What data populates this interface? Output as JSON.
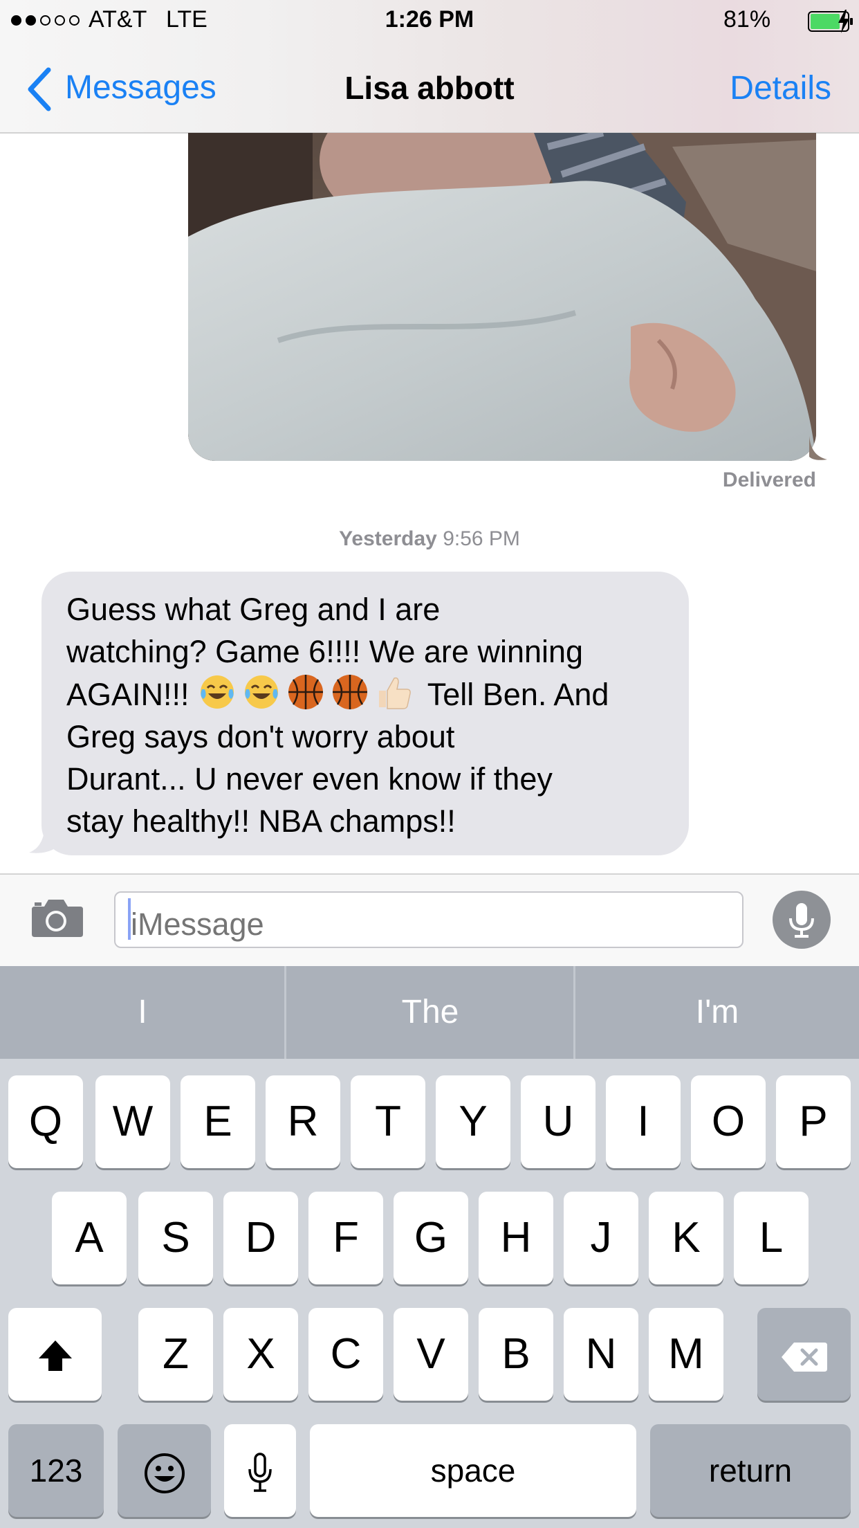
{
  "status_bar": {
    "carrier": "AT&T",
    "network": "LTE",
    "time": "1:26 PM",
    "battery_percent": "81%",
    "battery_level": 0.81,
    "signal_bars": 2,
    "signal_max": 5,
    "colors": {
      "battery": "#4cd964"
    }
  },
  "nav": {
    "back_label": "Messages",
    "title": "Lisa abbott",
    "details_label": "Details",
    "accent_color": "#1a81f4"
  },
  "conversation": {
    "photo_message": {
      "icon": "photo-attachment",
      "status": "Delivered"
    },
    "timestamp": {
      "day": "Yesterday",
      "time": "9:56 PM"
    },
    "received_message": {
      "line1": "Guess what Greg and I are",
      "line2": "watching? Game 6!!!! We are winning",
      "line3_start": "AGAIN!!!",
      "line3_end": "Tell Ben. And",
      "line4": "Greg says don't worry about",
      "line5": "Durant... U never even know if they",
      "line6": "stay healthy!! NBA champs!!",
      "emojis": [
        "tears-of-joy",
        "tears-of-joy",
        "basketball",
        "basketball",
        "thumbs-up"
      ],
      "bubble_color": "#e5e5ea"
    }
  },
  "composer": {
    "camera_icon": "camera-icon",
    "placeholder": "iMessage",
    "mic_icon": "microphone-icon"
  },
  "keyboard": {
    "predictions": [
      "I",
      "The",
      "I'm"
    ],
    "row1": [
      "Q",
      "W",
      "E",
      "R",
      "T",
      "Y",
      "U",
      "I",
      "O",
      "P"
    ],
    "row2": [
      "A",
      "S",
      "D",
      "F",
      "G",
      "H",
      "J",
      "K",
      "L"
    ],
    "row3": [
      "Z",
      "X",
      "C",
      "V",
      "B",
      "N",
      "M"
    ],
    "numbers_label": "123",
    "space_label": "space",
    "return_label": "return",
    "shift_icon": "shift-icon",
    "delete_icon": "delete-icon",
    "emoji_icon": "emoji-icon",
    "dictation_icon": "dictation-icon"
  }
}
